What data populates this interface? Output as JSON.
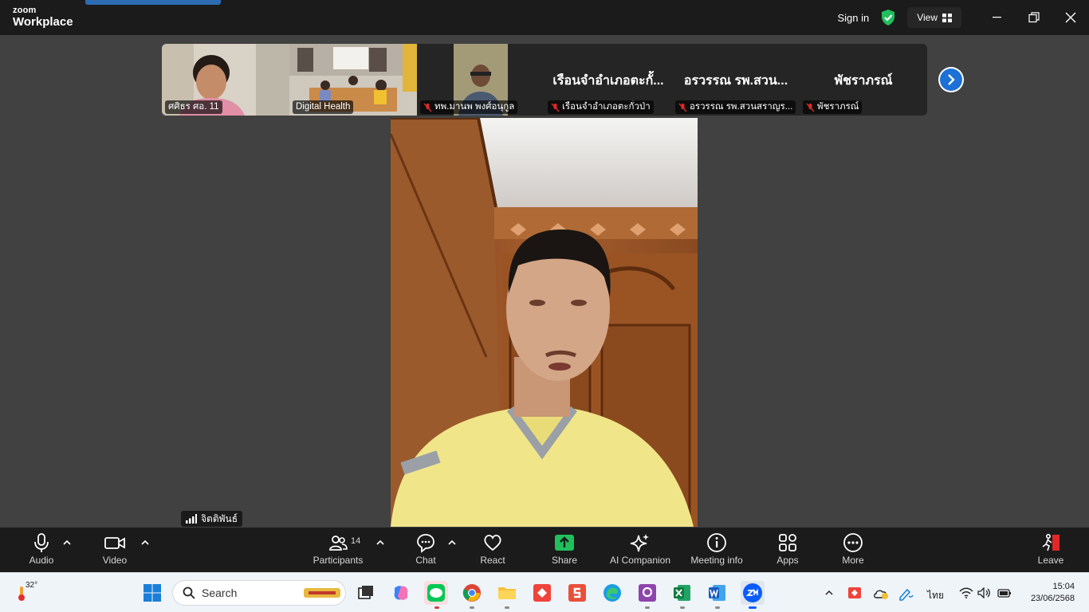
{
  "app": {
    "brand_small": "zoom",
    "brand_large": "Workplace"
  },
  "titlebar": {
    "sign_in": "Sign in",
    "view": "View"
  },
  "gallery": [
    {
      "label": "ศศิธร ศอ. 11",
      "muted": false,
      "video": "person"
    },
    {
      "label": "Digital Health",
      "muted": false,
      "video": "room"
    },
    {
      "label": "ทพ.มานพ พงศ์อนุกูล",
      "muted": true,
      "video": "person2"
    },
    {
      "label": "เรือนจำอำเภอตะกั่วป่า",
      "muted": true,
      "display_name": "เรือนจำอำเภอตะกั้..."
    },
    {
      "label": "อรวรรณ รพ.สวนสราญร...",
      "muted": true,
      "display_name": "อรวรรณ รพ.สวน..."
    },
    {
      "label": "พัชราภรณ์",
      "muted": true,
      "display_name": "พัชราภรณ์"
    }
  ],
  "self_view": {
    "name": "จิตติพันธ์"
  },
  "toolbar": {
    "audio": "Audio",
    "video": "Video",
    "participants": "Participants",
    "participants_count": "14",
    "chat": "Chat",
    "react": "React",
    "share": "Share",
    "ai_companion": "AI Companion",
    "meeting_info": "Meeting info",
    "apps": "Apps",
    "more": "More",
    "leave": "Leave"
  },
  "taskbar": {
    "weather_temp": "32°",
    "search_placeholder": "Search",
    "language": "ไทย",
    "time": "15:04",
    "date": "23/06/2568"
  },
  "colors": {
    "accent": "#1c70d6",
    "share_green": "#20c05c",
    "leave_red": "#e02828"
  }
}
